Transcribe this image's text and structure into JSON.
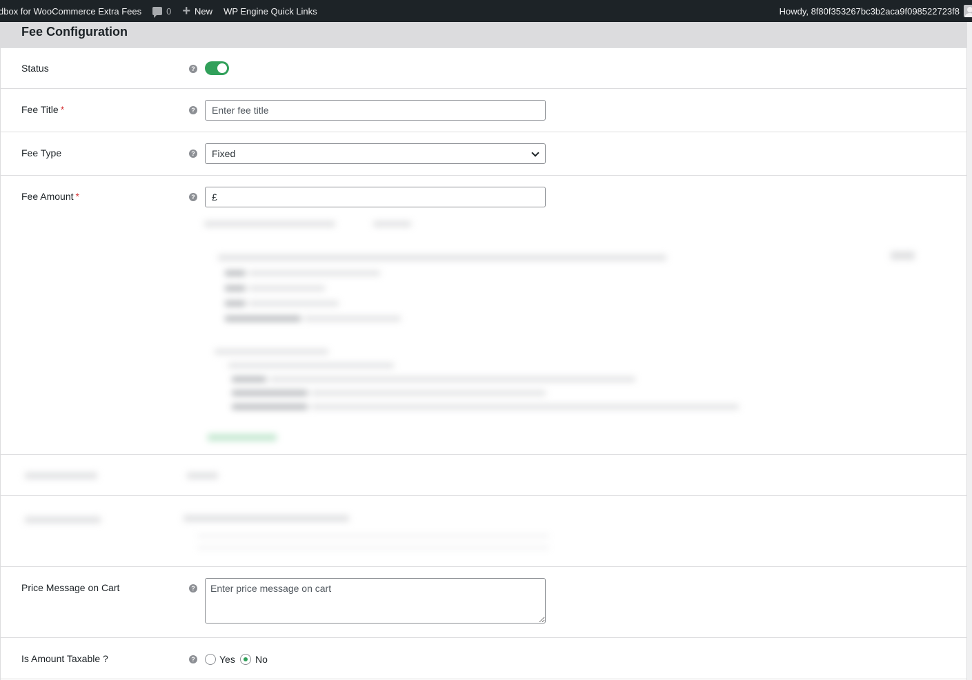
{
  "adminbar": {
    "site_name": "dbox for WooCommerce Extra Fees",
    "comments_count": "0",
    "new_label": "New",
    "quick_links_label": "WP Engine Quick Links",
    "howdy": "Howdy, 8f80f353267bc3b2aca9f098522723f8"
  },
  "panel": {
    "title": "Fee Configuration"
  },
  "fields": {
    "status": {
      "label": "Status",
      "enabled": true
    },
    "fee_title": {
      "label": "Fee Title",
      "required_mark": "*",
      "placeholder": "Enter fee title",
      "value": ""
    },
    "fee_type": {
      "label": "Fee Type",
      "selected": "Fixed"
    },
    "fee_amount": {
      "label": "Fee Amount",
      "required_mark": "*",
      "value": "£"
    },
    "price_message": {
      "label": "Price Message on Cart",
      "placeholder": "Enter price message on cart",
      "value": ""
    },
    "taxable": {
      "label": "Is Amount Taxable ?",
      "option_yes": "Yes",
      "option_no": "No",
      "selected": "No"
    }
  },
  "icons": {
    "help": "help-icon",
    "chevron": "chevron-down-icon"
  },
  "colors": {
    "adminbar_bg": "#1d2327",
    "toggle_on": "#31a05a",
    "required": "#d63638",
    "panel_header": "#dcdcde"
  }
}
